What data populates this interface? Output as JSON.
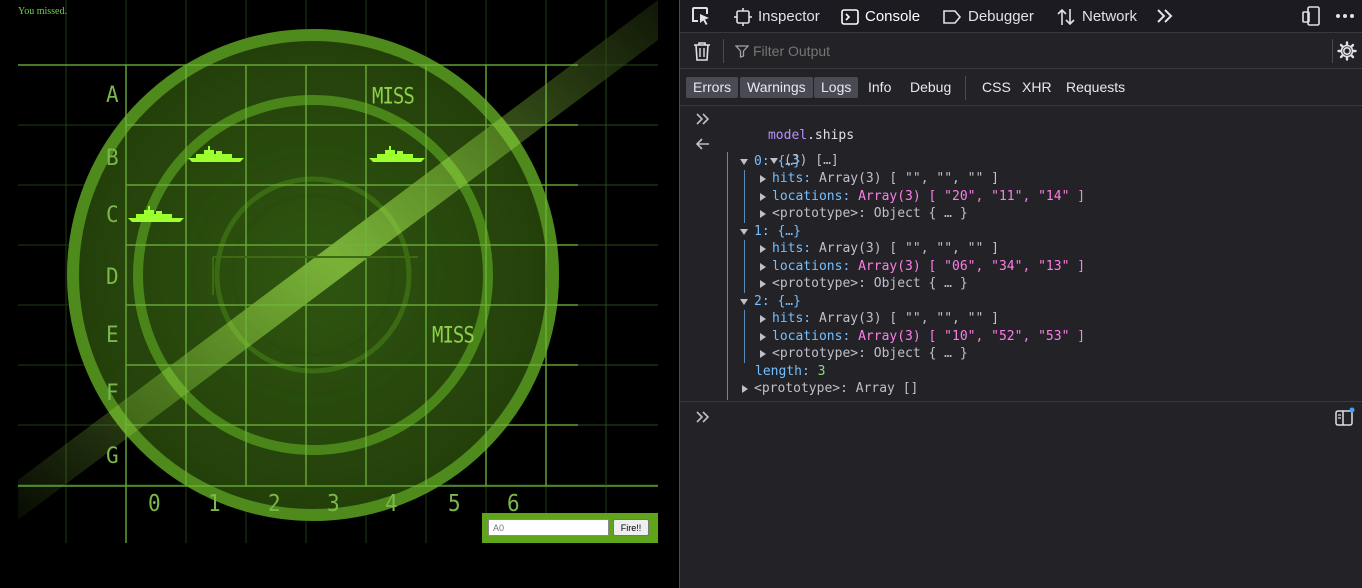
{
  "game": {
    "message": "You missed.",
    "rows": [
      "A",
      "B",
      "C",
      "D",
      "E",
      "F",
      "G"
    ],
    "cols": [
      "0",
      "1",
      "2",
      "3",
      "4",
      "5",
      "6"
    ],
    "miss_label": "MISS",
    "guess_placeholder": "A0",
    "fire_label": "Fire!!",
    "colors": {
      "grid": "#6fb63a",
      "radar": "#3d6b12",
      "ship": "#9cff2e",
      "form_bg": "#5ea51c"
    }
  },
  "devtools": {
    "tabs": {
      "inspector": "Inspector",
      "console": "Console",
      "debugger": "Debugger",
      "network": "Network"
    },
    "filter_placeholder": "Filter Output",
    "levels": {
      "errors": "Errors",
      "warnings": "Warnings",
      "logs": "Logs",
      "info": "Info",
      "debug": "Debug",
      "css": "CSS",
      "xhr": "XHR",
      "requests": "Requests"
    },
    "console": {
      "input_obj": "model",
      "input_prop": ".ships",
      "result_summary": "(3) […]",
      "ships": [
        {
          "index": "0: {…}",
          "hits": "hits: ",
          "hits_val": "Array(3) [ \"\", \"\", \"\" ]",
          "loc": "locations: ",
          "loc_val": "Array(3) [ \"20\", \"11\", \"14\" ]",
          "proto": "<prototype>: Object { … }"
        },
        {
          "index": "1: {…}",
          "hits": "hits: ",
          "hits_val": "Array(3) [ \"\", \"\", \"\" ]",
          "loc": "locations: ",
          "loc_val": "Array(3) [ \"06\", \"34\", \"13\" ]",
          "proto": "<prototype>: Object { … }"
        },
        {
          "index": "2: {…}",
          "hits": "hits: ",
          "hits_val": "Array(3) [ \"\", \"\", \"\" ]",
          "loc": "locations: ",
          "loc_val": "Array(3) [ \"10\", \"52\", \"53\" ]",
          "proto": "<prototype>: Object { … }"
        }
      ],
      "length_key": "length: ",
      "length_val": "3",
      "array_proto": "<prototype>: Array []"
    }
  }
}
